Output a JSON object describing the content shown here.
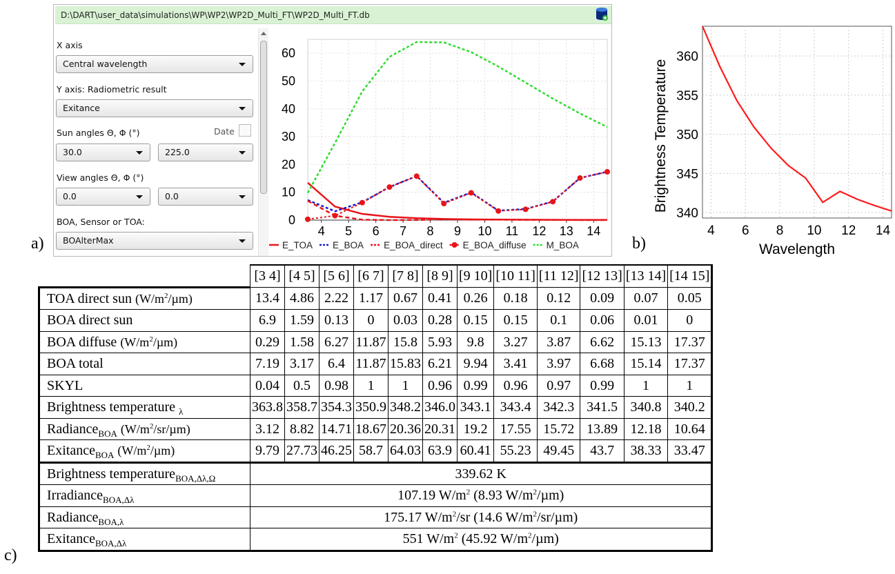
{
  "panel_labels": {
    "a": "a)",
    "b": "b)",
    "c": "c)"
  },
  "dart_window": {
    "path": "D:\\DART\\user_data\\simulations\\WP\\WP2\\WP2D_Multi_FT\\WP2D_Multi_FT.db",
    "db_icon": "database-add-icon",
    "controls": {
      "x_axis_label": "X axis",
      "x_axis_value": "Central wavelength",
      "y_axis_label": "Y axis: Radiometric result",
      "y_axis_value": "Exitance",
      "sun_angles_label": "Sun angles Θ, Φ  (°)",
      "date_label": "Date",
      "sun_theta": "30.0",
      "sun_phi": "225.0",
      "view_angles_label": "View angles Θ, Φ  (°)",
      "view_theta": "0.0",
      "view_phi": "0.0",
      "boa_label": "BOA, Sensor or TOA:",
      "boa_value": "BOAlterMax"
    }
  },
  "chart_data": [
    {
      "type": "line",
      "x": [
        3.5,
        4.5,
        5.5,
        6.5,
        7.5,
        8.5,
        9.5,
        10.5,
        11.5,
        12.5,
        13.5,
        14.5
      ],
      "xlim": [
        3.5,
        14.5
      ],
      "ylim": [
        0,
        65
      ],
      "xticks": [
        4,
        5,
        6,
        7,
        8,
        9,
        10,
        11,
        12,
        13,
        14
      ],
      "yticks": [
        0,
        10,
        20,
        30,
        40,
        50,
        60
      ],
      "grid": true,
      "legend_position": "bottom",
      "series": [
        {
          "name": "E_TOA",
          "color": "#e8141a",
          "style": "solid",
          "values": [
            13.4,
            4.86,
            2.22,
            1.17,
            0.67,
            0.41,
            0.26,
            0.18,
            0.12,
            0.09,
            0.07,
            0.05
          ]
        },
        {
          "name": "E_BOA",
          "color": "#1a1acc",
          "style": "dotted",
          "values": [
            7.19,
            3.17,
            6.4,
            11.87,
            15.83,
            6.21,
            9.94,
            3.41,
            3.97,
            6.68,
            15.14,
            17.37
          ]
        },
        {
          "name": "E_BOA_direct",
          "color": "#e8141a",
          "style": "dashed",
          "values": [
            6.9,
            1.59,
            0.13,
            0,
            0.03,
            0.28,
            0.15,
            0.15,
            0.1,
            0.06,
            0.01,
            0
          ]
        },
        {
          "name": "E_BOA_diffuse",
          "color": "#e8141a",
          "style": "markers",
          "values": [
            0.29,
            1.58,
            6.27,
            11.87,
            15.8,
            5.93,
            9.8,
            3.27,
            3.87,
            6.62,
            15.13,
            17.37
          ]
        },
        {
          "name": "M_BOA",
          "color": "#2edc2e",
          "style": "dotted",
          "values": [
            9.79,
            27.73,
            46.25,
            58.7,
            64.03,
            63.9,
            60.41,
            55.23,
            49.45,
            43.7,
            38.33,
            33.47
          ]
        }
      ]
    },
    {
      "type": "line",
      "xlabel": "Wavelength",
      "ylabel": "Brightness Temperature",
      "x": [
        3.5,
        4.5,
        5.5,
        6.5,
        7.5,
        8.5,
        9.5,
        10.5,
        11.5,
        12.5,
        13.5,
        14.5
      ],
      "xlim": [
        3.5,
        14.5
      ],
      "ylim": [
        339.3,
        363.8
      ],
      "xticks": [
        4,
        6,
        8,
        10,
        12,
        14
      ],
      "yticks": [
        340,
        345,
        350,
        355,
        360
      ],
      "grid": true,
      "series": [
        {
          "color": "#ff1a1a",
          "values": [
            363.8,
            358.7,
            354.3,
            350.9,
            348.2,
            346.0,
            344.4,
            341.3,
            342.7,
            341.7,
            340.9,
            340.2
          ]
        }
      ]
    }
  ],
  "table": {
    "intervals": [
      "[3  4]",
      "[4  5]",
      "[5  6]",
      "[6  7]",
      "[7  8]",
      "[8  9]",
      "[9 10]",
      "[10 11]",
      "[11 12]",
      "[12 13]",
      "[13 14]",
      "[14 15]"
    ],
    "rows": [
      {
        "name": "TOA direct sun",
        "sub": "",
        "unit": "(W/m²/µm)",
        "values": [
          "13.4",
          "4.86",
          "2.22",
          "1.17",
          "0.67",
          "0.41",
          "0.26",
          "0.18",
          "0.12",
          "0.09",
          "0.07",
          "0.05"
        ]
      },
      {
        "name": "BOA direct sun",
        "sub": "",
        "unit": "",
        "values": [
          "6.9",
          "1.59",
          "0.13",
          "0",
          "0.03",
          "0.28",
          "0.15",
          "0.15",
          "0.1",
          "0.06",
          "0.01",
          "0"
        ]
      },
      {
        "name": "BOA diffuse",
        "sub": "",
        "unit": "(W/m²/µm)",
        "values": [
          "0.29",
          "1.58",
          "6.27",
          "11.87",
          "15.8",
          "5.93",
          "9.8",
          "3.27",
          "3.87",
          "6.62",
          "15.13",
          "17.37"
        ]
      },
      {
        "name": "BOA total",
        "sub": "",
        "unit": "",
        "values": [
          "7.19",
          "3.17",
          "6.4",
          "11.87",
          "15.83",
          "6.21",
          "9.94",
          "3.41",
          "3.97",
          "6.68",
          "15.14",
          "17.37"
        ]
      },
      {
        "name": "SKYL",
        "sub": "",
        "unit": "",
        "values": [
          "0.04",
          "0.5",
          "0.98",
          "1",
          "1",
          "0.96",
          "0.99",
          "0.96",
          "0.97",
          "0.99",
          "1",
          "1"
        ]
      },
      {
        "name": "Brightness temperature ",
        "sub": "λ",
        "unit": "",
        "values": [
          "363.8",
          "358.7",
          "354.3",
          "350.9",
          "348.2",
          "346.0",
          "343.1",
          "343.4",
          "342.3",
          "341.5",
          "340.8",
          "340.2"
        ]
      },
      {
        "name": "Radiance",
        "sub": "BOA",
        "unit": "(W/m²/sr/µm)",
        "values": [
          "3.12",
          "8.82",
          "14.71",
          "18.67",
          "20.36",
          "20.31",
          "19.2",
          "17.55",
          "15.72",
          "13.89",
          "12.18",
          "10.64"
        ]
      },
      {
        "name": "Exitance",
        "sub": "BOA",
        "unit": "(W/m²/µm)",
        "values": [
          "9.79",
          "27.73",
          "46.25",
          "58.7",
          "64.03",
          "63.9",
          "60.41",
          "55.23",
          "49.45",
          "43.7",
          "38.33",
          "33.47"
        ]
      }
    ],
    "summary": [
      {
        "name": "Brightness temperature",
        "sub": "BOA,Δλ,Ω",
        "value": "339.62 K"
      },
      {
        "name": "Irradiance",
        "sub": "BOA,Δλ",
        "value": "107.19 W/m² (8.93 W/m²/µm)"
      },
      {
        "name": "Radiance",
        "sub": "BOA,λ",
        "value": "175.17 W/m²/sr (14.6 W/m²/sr/µm)"
      },
      {
        "name": "Exitance",
        "sub": "BOA,Δλ",
        "value": "551 W/m² (45.92 W/m²/µm)"
      }
    ]
  }
}
